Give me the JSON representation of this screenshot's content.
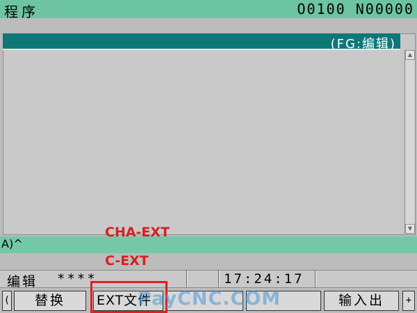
{
  "titlebar": {
    "title": "程序",
    "program_number": "O0100 N00000"
  },
  "program_panel": {
    "mode_label": "(FG:编辑)"
  },
  "scrollbar": {
    "up_glyph": "▲",
    "down_glyph": "▼"
  },
  "input_line": {
    "prompt": "A)^"
  },
  "status": {
    "mode": "编辑",
    "stars": "****",
    "clock": "17:24:17"
  },
  "softkeys": {
    "left_arrow": "(",
    "right_arrow": "+",
    "keys": [
      {
        "label": "替换"
      },
      {
        "label": "EXT文件"
      },
      {
        "label": ""
      },
      {
        "label": ""
      },
      {
        "label": "输入出"
      }
    ]
  },
  "annotations": {
    "cha_ext": "CHA-EXT",
    "c_ext": "C-EXT",
    "watermark": "PayCNC.COM"
  },
  "colors": {
    "titlebar_bg": "#6cc4a4",
    "panel_header_bg": "#0e7878",
    "input_line_bg": "#74c8a6",
    "annotation_red": "#e02020"
  }
}
